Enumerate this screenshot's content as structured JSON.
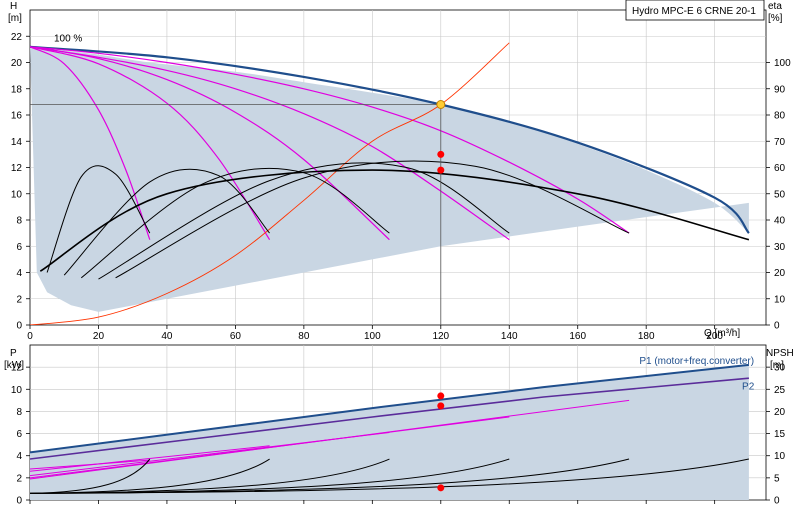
{
  "chart_data": [
    {
      "type": "line",
      "title": "Hydro MPC-E 6 CRNE 20-1",
      "xlabel": "Q [m³/h]",
      "ylabel_left": "H [m]",
      "ylabel_right": "eta [%]",
      "xlim": [
        0,
        215
      ],
      "ylim_left": [
        0,
        24
      ],
      "ylim_right": [
        0,
        120
      ],
      "xticks": [
        0,
        20,
        40,
        60,
        80,
        100,
        120,
        140,
        160,
        180,
        200
      ],
      "yticks_left": [
        0,
        2,
        4,
        6,
        8,
        10,
        12,
        14,
        16,
        18,
        20,
        22
      ],
      "yticks_right": [
        0,
        10,
        20,
        30,
        40,
        50,
        60,
        70,
        80,
        90,
        100
      ],
      "grid": true,
      "annotations": [
        "100 %"
      ],
      "colors": {
        "max_curve": "#1f4e8c",
        "speed_curves": "#e000e0",
        "efficiency": "#000000",
        "system": "#ff3300",
        "fill": "#c9d6e3",
        "marker": "#ff0000",
        "duty_marker": "#ffcc33"
      },
      "duty_point": {
        "x": 120,
        "y": 16.8
      },
      "red_markers": [
        {
          "x": 120,
          "y": 13.0
        },
        {
          "x": 120,
          "y": 11.8
        }
      ],
      "series": [
        {
          "type": "area",
          "x": [
            0,
            20,
            35,
            60,
            80,
            100,
            120,
            140,
            160,
            180,
            200,
            210
          ],
          "y": [
            21.2,
            20.6,
            20.0,
            19.3,
            18.5,
            17.7,
            16.8,
            15.5,
            13.8,
            11.8,
            9.3,
            7.0
          ]
        },
        {
          "type": "area",
          "x": [
            2,
            5,
            12,
            20,
            40,
            80,
            120,
            160,
            210
          ],
          "y": [
            4,
            2.5,
            1.5,
            1.0,
            2.0,
            4.0,
            6.0,
            7.5,
            9.3
          ]
        },
        {
          "type": "line",
          "x": [
            0,
            40,
            80,
            120,
            160,
            200,
            210
          ],
          "y": [
            21.2,
            20.4,
            18.9,
            16.8,
            13.9,
            9.7,
            7.0
          ]
        },
        {
          "type": "line",
          "x": [
            0,
            20,
            40,
            60,
            80,
            100,
            120,
            140,
            160,
            175
          ],
          "y": [
            21.2,
            20.7,
            20.0,
            19.1,
            18.0,
            16.6,
            14.8,
            12.4,
            9.6,
            7.0
          ]
        },
        {
          "type": "line",
          "x": [
            0,
            20,
            40,
            60,
            80,
            100,
            120,
            140
          ],
          "y": [
            21.2,
            20.4,
            19.4,
            18.0,
            16.1,
            13.6,
            10.2,
            6.5
          ]
        },
        {
          "type": "line",
          "x": [
            0,
            20,
            40,
            60,
            80,
            105
          ],
          "y": [
            21.2,
            20.3,
            18.7,
            16.2,
            12.6,
            6.5
          ]
        },
        {
          "type": "line",
          "x": [
            0,
            20,
            40,
            55,
            70
          ],
          "y": [
            21.2,
            19.9,
            16.9,
            12.7,
            6.5
          ]
        },
        {
          "type": "line",
          "x": [
            0,
            10,
            20,
            28,
            35
          ],
          "y": [
            21.2,
            19.9,
            16.4,
            11.8,
            6.5
          ]
        },
        {
          "type": "line",
          "x": [
            0,
            20,
            40,
            60,
            80,
            100,
            120,
            140
          ],
          "y": [
            0,
            0.6,
            2.4,
            5.3,
            9.5,
            14.0,
            16.8,
            21.5
          ]
        },
        {
          "type": "line",
          "x": [
            5,
            15,
            25,
            35
          ],
          "y": [
            4.0,
            11.3,
            11.5,
            7.0
          ]
        },
        {
          "type": "line",
          "x": [
            10,
            35,
            55,
            70
          ],
          "y": [
            3.8,
            10.9,
            11.4,
            7.0
          ]
        },
        {
          "type": "line",
          "x": [
            15,
            50,
            80,
            105
          ],
          "y": [
            3.6,
            10.7,
            11.6,
            7.0
          ]
        },
        {
          "type": "line",
          "x": [
            20,
            70,
            110,
            140
          ],
          "y": [
            3.5,
            11.0,
            12.0,
            7.0
          ]
        },
        {
          "type": "line",
          "x": [
            25,
            80,
            130,
            175
          ],
          "y": [
            3.6,
            11.2,
            12.1,
            7.0
          ]
        },
        {
          "type": "line",
          "x": [
            3,
            40,
            100,
            160,
            210
          ],
          "y": [
            4.1,
            10.0,
            11.8,
            10.0,
            6.5
          ]
        }
      ]
    },
    {
      "type": "line",
      "xlabel": "Q [m³/h]",
      "ylabel_left": "P [kW]",
      "ylabel_right": "NPSH [m]",
      "xlim": [
        0,
        215
      ],
      "ylim_left": [
        0,
        14
      ],
      "ylim_right": [
        0,
        35
      ],
      "yticks_left": [
        0,
        2,
        4,
        6,
        8,
        10,
        12
      ],
      "yticks_right": [
        0,
        5,
        10,
        15,
        20,
        25,
        30
      ],
      "grid": true,
      "red_markers": [
        {
          "x": 120,
          "y": 9.4
        },
        {
          "x": 120,
          "y": 8.5
        },
        {
          "x": 120,
          "y": 1.1
        }
      ],
      "series": [
        {
          "name": "P1 (motor+freq.converter)",
          "type": "line",
          "x": [
            0,
            50,
            100,
            150,
            210
          ],
          "y": [
            4.3,
            6.3,
            8.3,
            10.2,
            12.2
          ]
        },
        {
          "name": "P2",
          "type": "line",
          "x": [
            0,
            50,
            100,
            150,
            210
          ],
          "y": [
            3.7,
            5.6,
            7.5,
            9.3,
            11.0
          ]
        },
        {
          "type": "area",
          "x": [
            0,
            210
          ],
          "y": [
            0.5,
            12.2
          ]
        },
        {
          "type": "line",
          "x": [
            0,
            35
          ],
          "y": [
            2.8,
            3.6
          ]
        },
        {
          "type": "line",
          "x": [
            0,
            70
          ],
          "y": [
            2.6,
            4.9
          ]
        },
        {
          "type": "line",
          "x": [
            0,
            105
          ],
          "y": [
            2.2,
            6.1
          ]
        },
        {
          "type": "line",
          "x": [
            0,
            140
          ],
          "y": [
            2.0,
            7.5
          ]
        },
        {
          "type": "line",
          "x": [
            0,
            175
          ],
          "y": [
            1.9,
            9.0
          ]
        },
        {
          "type": "line",
          "x": [
            0,
            35
          ],
          "y": [
            0.6,
            3.7
          ]
        },
        {
          "type": "line",
          "x": [
            0,
            70
          ],
          "y": [
            0.6,
            3.7
          ]
        },
        {
          "type": "line",
          "x": [
            0,
            105
          ],
          "y": [
            0.6,
            3.7
          ]
        },
        {
          "type": "line",
          "x": [
            0,
            140
          ],
          "y": [
            0.6,
            3.7
          ]
        },
        {
          "type": "line",
          "x": [
            0,
            175
          ],
          "y": [
            0.6,
            3.7
          ]
        },
        {
          "type": "line",
          "x": [
            0,
            210
          ],
          "y": [
            0.6,
            3.7
          ]
        }
      ]
    }
  ]
}
